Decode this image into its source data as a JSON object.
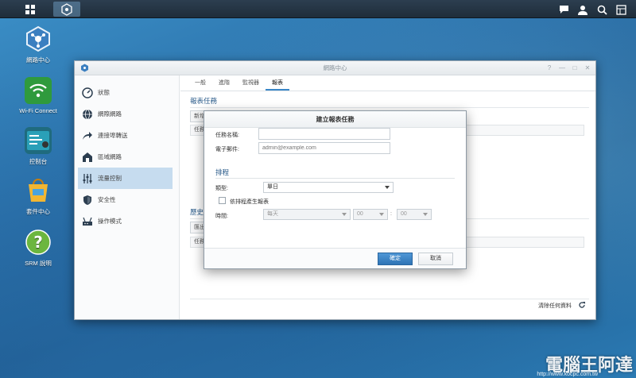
{
  "desktop": {
    "icons": [
      {
        "label": "網路中心",
        "icon": "network-center-icon"
      },
      {
        "label": "Wi-Fi Connect",
        "icon": "wifi-icon"
      },
      {
        "label": "控制台",
        "icon": "control-panel-icon"
      },
      {
        "label": "套件中心",
        "icon": "package-center-icon"
      },
      {
        "label": "SRM 說明",
        "icon": "help-icon"
      }
    ]
  },
  "window": {
    "title": "網路中心",
    "sidebar": [
      {
        "label": "狀態",
        "icon": "status-gauge-icon"
      },
      {
        "label": "網際網路",
        "icon": "internet-globe-icon"
      },
      {
        "label": "連接埠轉送",
        "icon": "port-forward-arrow-icon"
      },
      {
        "label": "區域網路",
        "icon": "local-network-icon"
      },
      {
        "label": "流量控制",
        "icon": "traffic-control-icon"
      },
      {
        "label": "安全性",
        "icon": "security-shield-icon"
      },
      {
        "label": "操作模式",
        "icon": "operation-mode-icon"
      }
    ],
    "tabs": [
      "一般",
      "進階",
      "監視器",
      "報表"
    ],
    "section_report_task": "報表任務",
    "new_button": "新增",
    "table_col": "任務",
    "section_history": "歷史",
    "history_button": "匯出",
    "history_col": "任務",
    "footer_clear": "清除任何資料"
  },
  "dialog": {
    "title": "建立報表任務",
    "task_name_label": "任務名稱:",
    "task_name_value": "",
    "email_label": "電子郵件:",
    "email_placeholder": "admin@example.com",
    "schedule_section": "排程",
    "type_label": "類型:",
    "type_value": "單日",
    "checkbox_label": "依排程產生報表",
    "time_label": "時間:",
    "time_day": "每天",
    "time_hour": "00",
    "time_sep": ":",
    "time_minute": "00",
    "ok_button": "確定",
    "cancel_button": "取消"
  },
  "watermark": {
    "text": "電腦王阿達",
    "url": "http://www.kocpc.com.tw"
  },
  "colors": {
    "accent": "#3a87c8",
    "section": "#2a5b8a"
  }
}
